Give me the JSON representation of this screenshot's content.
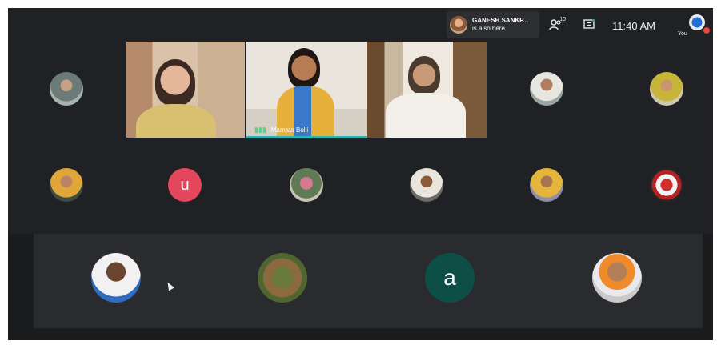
{
  "notification": {
    "name": "GANESH SANKP...",
    "message": "is also here"
  },
  "topbar": {
    "people_count": "10",
    "time": "11:40 AM",
    "self_label": "You"
  },
  "videos": [
    {
      "id": "vid1",
      "label": ""
    },
    {
      "id": "vid2",
      "label": "Mamata Bolli"
    },
    {
      "id": "vid3",
      "label": ""
    }
  ],
  "avatars": {
    "u_letter": "u",
    "a_letter": "a"
  },
  "colors": {
    "background": "#202124",
    "active_speaker": "#2bb5b5",
    "avatar_u": "#e4475b",
    "avatar_a": "#0d4f47",
    "mic_active": "#5bd08f"
  }
}
